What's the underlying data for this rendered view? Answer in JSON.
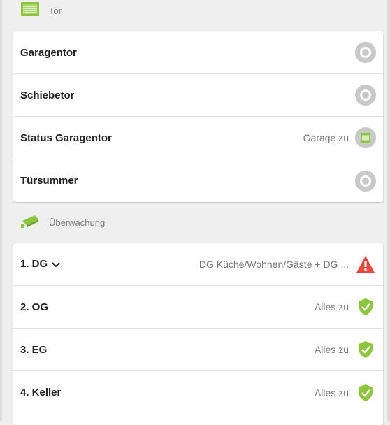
{
  "sections": [
    {
      "title": "Tor",
      "icon": "garage-door-icon",
      "rows": [
        {
          "label": "Garagentor",
          "value": "",
          "icon": "toggle-circle-icon"
        },
        {
          "label": "Schiebetor",
          "value": "",
          "icon": "toggle-circle-icon"
        },
        {
          "label": "Status Garagentor",
          "value": "Garage zu",
          "icon": "garage-closed-icon"
        },
        {
          "label": "Türsummer",
          "value": "",
          "icon": "toggle-circle-icon"
        }
      ]
    },
    {
      "title": "Überwachung",
      "icon": "security-camera-icon",
      "rows": [
        {
          "label": "1. DG",
          "value": "DG Küche/Wohnen/Gäste + DG ...",
          "icon": "warning-triangle-icon",
          "has_dropdown": true
        },
        {
          "label": "2. OG",
          "value": "Alles zu",
          "icon": "shield-check-icon"
        },
        {
          "label": "3. EG",
          "value": "Alles zu",
          "icon": "shield-check-icon"
        },
        {
          "label": "4. Keller",
          "value": "Alles zu",
          "icon": "shield-check-icon"
        }
      ]
    }
  ],
  "colors": {
    "accent_green": "#8cc63f",
    "alert_red": "#e5473c",
    "toggle_grey": "#c9c9c9"
  }
}
